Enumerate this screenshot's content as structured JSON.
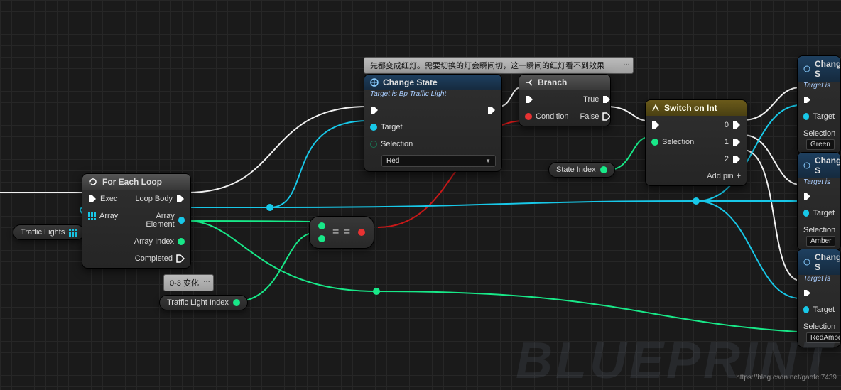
{
  "comments": {
    "top": "先都变成红灯。需要切换的灯会瞬间切，这一瞬间的红灯看不到效果",
    "index_range": "0-3 变化"
  },
  "vars": {
    "traffic_lights": "Traffic Lights",
    "state_index": "State Index",
    "traffic_light_index": "Traffic Light Index"
  },
  "foreach": {
    "title": "For Each Loop",
    "exec": "Exec",
    "array": "Array",
    "loop_body": "Loop Body",
    "array_element": "Array Element",
    "array_index": "Array Index",
    "completed": "Completed"
  },
  "equal": {
    "symbol": "= ="
  },
  "change_state": {
    "title": "Change State",
    "subtitle": "Target is Bp Traffic Light",
    "target": "Target",
    "selection_label": "Selection",
    "selection_value": "Red"
  },
  "branch": {
    "title": "Branch",
    "condition": "Condition",
    "true": "True",
    "false": "False"
  },
  "switch": {
    "title": "Switch on Int",
    "selection": "Selection",
    "outs": [
      "0",
      "1",
      "2"
    ],
    "add_pin": "Add pin"
  },
  "cs_nodes": [
    {
      "title": "Change S",
      "sub": "Target is ",
      "target": "Target",
      "selection_label": "Selection",
      "value": "Green"
    },
    {
      "title": "Change S",
      "sub": "Target is ",
      "target": "Target",
      "selection_label": "Selection",
      "value": "Amber"
    },
    {
      "title": "Change S",
      "sub": "Target is ",
      "target": "Target",
      "selection_label": "Selection",
      "value": "RedAmbe"
    }
  ],
  "footer": {
    "watermark": "BLUEPRINT",
    "credit": "https://blog.csdn.net/gaofei7439"
  }
}
